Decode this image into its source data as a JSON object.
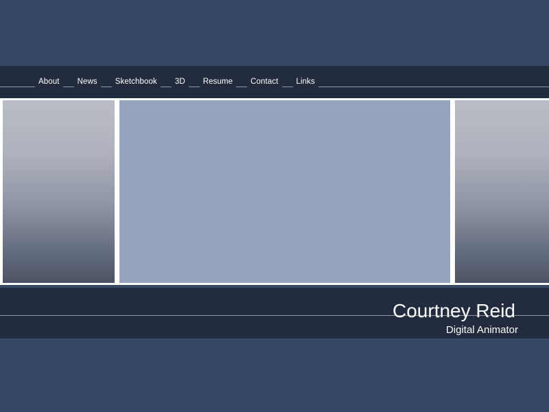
{
  "site": {
    "background_color": "#364764",
    "band_color": "#222c3e",
    "rule_color": "#8f96a4",
    "text_color": "#ffffff"
  },
  "nav": {
    "items": [
      {
        "label": "About"
      },
      {
        "label": "News"
      },
      {
        "label": "Sketchbook"
      },
      {
        "label": "3D"
      },
      {
        "label": "Resume"
      },
      {
        "label": "Contact"
      },
      {
        "label": "Links"
      }
    ]
  },
  "gallery": {
    "left_panel_color_top": "#b9bdc5",
    "left_panel_color_bottom": "#4a5263",
    "center_panel_color": "#96a3bd",
    "right_panel_color_top": "#b9bdc5",
    "right_panel_color_bottom": "#4a5263",
    "frame_color": "#ffffff"
  },
  "identity": {
    "name": "Courtney Reid",
    "role": "Digital Animator"
  }
}
